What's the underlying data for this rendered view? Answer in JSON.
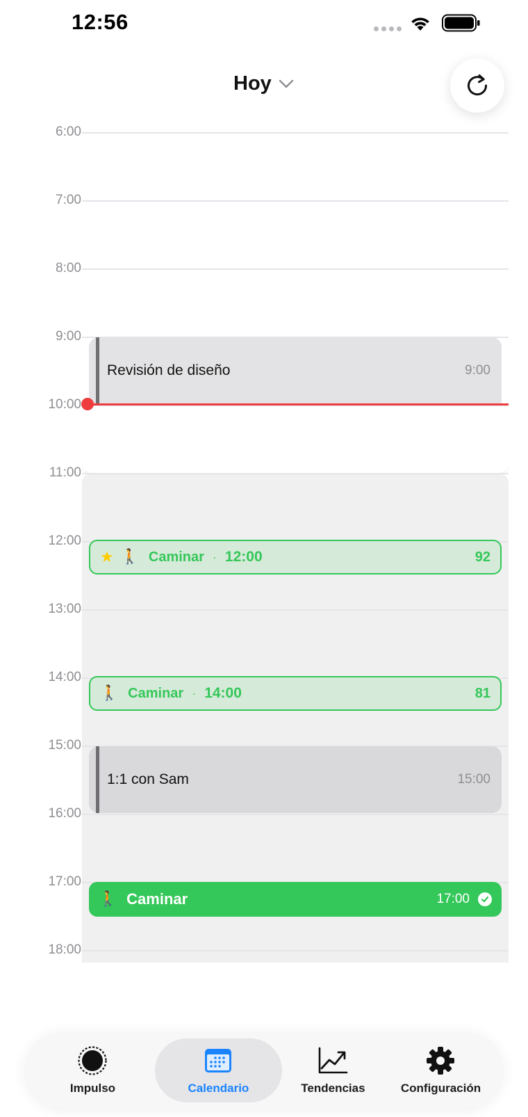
{
  "status_bar": {
    "time": "12:56"
  },
  "header": {
    "title": "Hoy"
  },
  "timeline": {
    "hours": [
      "6:00",
      "7:00",
      "8:00",
      "9:00",
      "10:00",
      "11:00",
      "12:00",
      "13:00",
      "14:00",
      "15:00",
      "16:00",
      "17:00",
      "18:00"
    ]
  },
  "events": {
    "design_review": {
      "title": "Revisión de diseño",
      "time": "9:00"
    },
    "one_on_one": {
      "title": "1:1 con Sam",
      "time": "15:00"
    }
  },
  "suggestions": {
    "walk_noon": {
      "label": "Caminar",
      "separator": "·",
      "time": "12:00",
      "score": "92"
    },
    "walk_afternoon": {
      "label": "Caminar",
      "separator": "·",
      "time": "14:00",
      "score": "81"
    }
  },
  "completed": {
    "walk_evening": {
      "title": "Caminar",
      "time": "17:00"
    }
  },
  "tab_bar": {
    "tabs": [
      {
        "label": "Impulso",
        "icon": "pulse-ring-icon",
        "active": false
      },
      {
        "label": "Calendario",
        "icon": "calendar-icon",
        "active": true
      },
      {
        "label": "Tendencias",
        "icon": "trend-chart-icon",
        "active": false
      },
      {
        "label": "Configuración",
        "icon": "gear-icon",
        "active": false
      }
    ]
  },
  "colors": {
    "accent": "#1a84ff",
    "success": "#34c759",
    "now_indicator": "#ef3d3d",
    "event_gray": "#e3e3e5"
  }
}
